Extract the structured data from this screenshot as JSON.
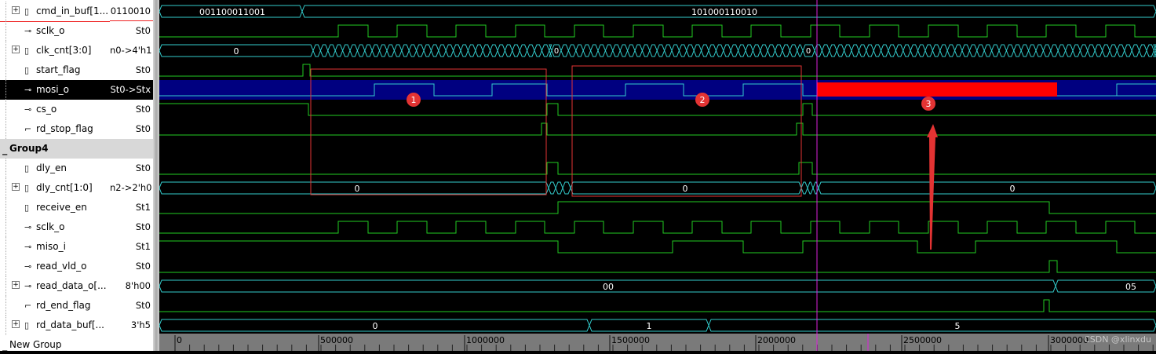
{
  "signals": [
    {
      "name": "cmd_in_buf[1...",
      "value": "0110010",
      "icon": "bus-icon",
      "expandable": true
    },
    {
      "name": "sclk_o",
      "value": "St0",
      "icon": "output-icon",
      "expandable": false
    },
    {
      "name": "clk_cnt[3:0]",
      "value": "n0->4'h1",
      "icon": "bus-icon",
      "expandable": true
    },
    {
      "name": "start_flag",
      "value": "St0",
      "icon": "reg-icon",
      "expandable": false
    },
    {
      "name": "mosi_o",
      "value": "St0->Stx",
      "icon": "output-icon",
      "expandable": false,
      "selected": true
    },
    {
      "name": "cs_o",
      "value": "St0",
      "icon": "output-icon",
      "expandable": false
    },
    {
      "name": "rd_stop_flag",
      "value": "St0",
      "icon": "wire-icon",
      "expandable": false
    },
    {
      "group": "Group4"
    },
    {
      "name": "dly_en",
      "value": "St0",
      "icon": "reg-icon",
      "expandable": false
    },
    {
      "name": "dly_cnt[1:0]",
      "value": "n2->2'h0",
      "icon": "bus-icon",
      "expandable": true
    },
    {
      "name": "receive_en",
      "value": "St1",
      "icon": "reg-icon",
      "expandable": false
    },
    {
      "name": "sclk_o",
      "value": "St0",
      "icon": "output-icon",
      "expandable": false
    },
    {
      "name": "miso_i",
      "value": "St1",
      "icon": "input-icon",
      "expandable": false
    },
    {
      "name": "read_vld_o",
      "value": "St0",
      "icon": "output-icon",
      "expandable": false
    },
    {
      "name": "read_data_o[...",
      "value": "8'h00",
      "icon": "output-icon",
      "expandable": true
    },
    {
      "name": "rd_end_flag",
      "value": "St0",
      "icon": "wire-icon",
      "expandable": false
    },
    {
      "name": "rd_data_buf[...",
      "value": "3'h5",
      "icon": "bus-icon",
      "expandable": true
    },
    {
      "group": "New Group"
    }
  ],
  "bus_labels": {
    "cmd_in_buf_a": "001100011001",
    "cmd_in_buf_b": "101000110010",
    "clk_cnt_0": "0",
    "dly_cnt_0": "0",
    "read_data_a": "00",
    "read_data_b": "05",
    "rd_data_buf_a": "0",
    "rd_data_buf_b": "1",
    "rd_data_buf_c": "5"
  },
  "markers": [
    "1",
    "2",
    "3"
  ],
  "timeline": {
    "labels": [
      "0",
      "500000",
      "1000000",
      "1500000",
      "2000000",
      "2500000",
      "3000000"
    ]
  },
  "watermark": "CSDN @xlinxdu",
  "colors": {
    "wave": "#22cc22",
    "bus": "#33cccc",
    "cursor": "#dd22dd",
    "selected_bg": "#000080",
    "unknown": "#ff0000",
    "annotation": "#e33333"
  }
}
